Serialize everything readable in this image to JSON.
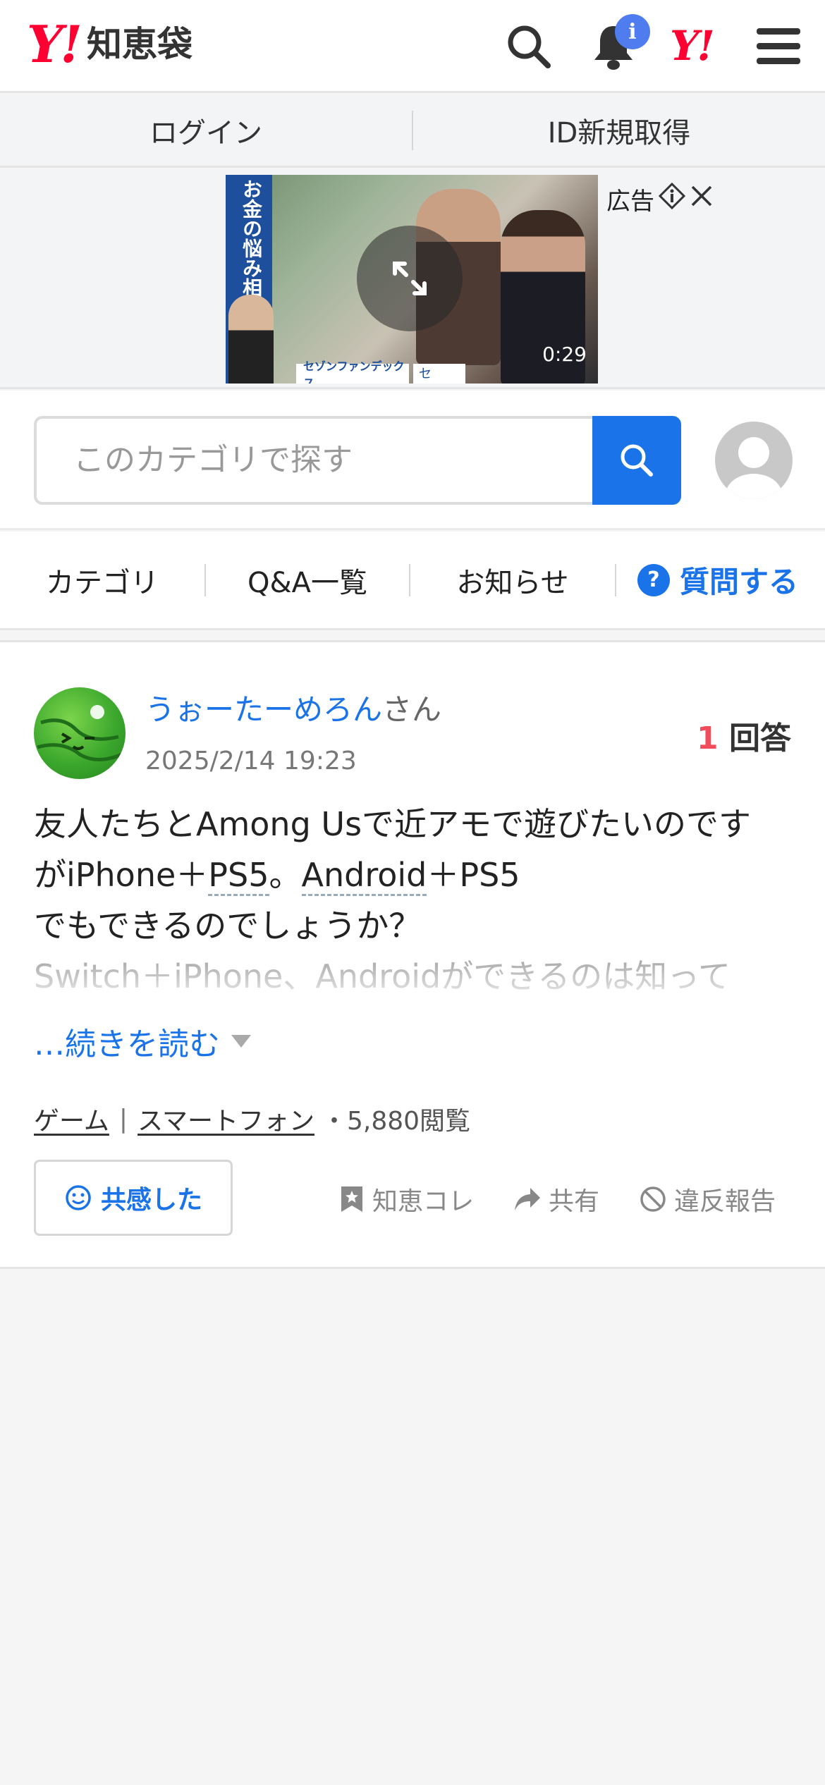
{
  "header": {
    "logo_mark": "Y!",
    "logo_text": "知恵袋",
    "notification_badge": "i",
    "yahoo_mark": "Y!"
  },
  "login_bar": {
    "login_label": "ログイン",
    "register_label": "ID新規取得"
  },
  "ad": {
    "banner_text": "お金の悩み相談",
    "duration": "0:29",
    "sponsor_logo": "セゾンファンデックス",
    "sponsor_logo2": "セ",
    "label": "広告"
  },
  "search": {
    "placeholder": "このカテゴリで探す"
  },
  "nav": {
    "items": [
      "カテゴリ",
      "Q&A一覧",
      "お知らせ"
    ],
    "ask_label": "質問する"
  },
  "question": {
    "username": "うぉーたーめろん",
    "honorific": "さん",
    "date": "2025/2/14 19:23",
    "answer_count": "1",
    "answer_label": "回答",
    "body_line1": "友人たちとAmong Usで近アモで遊びたいのです",
    "body_line2_prefix": "がiPhone＋",
    "body_line2_ps5": "PS5",
    "body_line2_mid": "。",
    "body_line2_android": "Android",
    "body_line2_suffix": "＋PS5",
    "body_line3": "でもできるのでしょうか？",
    "body_faded": "Switch＋iPhone、Androidができるのは知って",
    "read_more": "…続きを読む",
    "tags": [
      "ゲーム",
      "スマートフォン"
    ],
    "tag_separator": "|",
    "views": "・5,880閲覧",
    "empathy_label": "共感した",
    "actions": {
      "save": "知恵コレ",
      "share": "共有",
      "report": "違反報告"
    }
  }
}
